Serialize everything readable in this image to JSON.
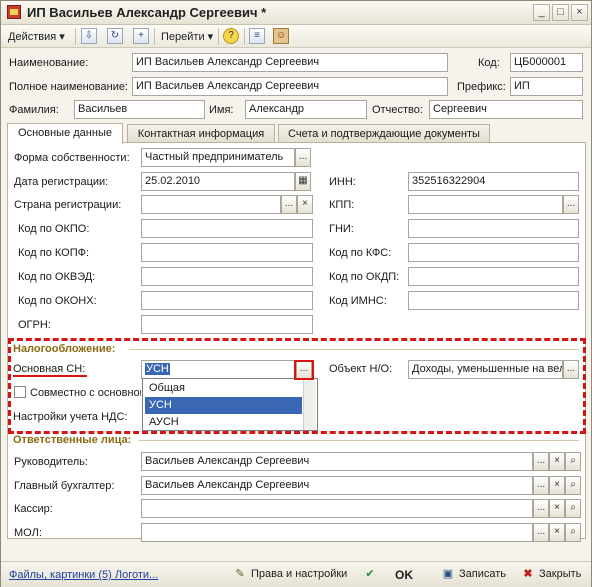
{
  "window": {
    "title": "ИП Васильев Александр Сергеевич *",
    "min_label": "_",
    "max_label": "□",
    "close_label": "×"
  },
  "toolbar": {
    "actions_label": "Действия",
    "goto_label": "Перейти",
    "help_label": "?"
  },
  "header": {
    "name_label": "Наименование:",
    "name_value": "ИП Васильев Александр Сергеевич",
    "code_label": "Код:",
    "code_value": "ЦБ000001",
    "fullname_label": "Полное наименование:",
    "fullname_value": "ИП Васильев Александр Сергеевич",
    "prefix_label": "Префикс:",
    "prefix_value": "ИП",
    "lastname_label": "Фамилия:",
    "lastname_value": "Васильев",
    "firstname_label": "Имя:",
    "firstname_value": "Александр",
    "patronymic_label": "Отчество:",
    "patronymic_value": "Сергеевич"
  },
  "tabs": [
    {
      "label": "Основные данные"
    },
    {
      "label": "Контактная информация"
    },
    {
      "label": "Счета и подтверждающие документы"
    }
  ],
  "main": {
    "ownership_label": "Форма собственности:",
    "ownership_value": "Частный предприниматель",
    "regdate_label": "Дата регистрации:",
    "regdate_value": "25.02.2010",
    "inn_label": "ИНН:",
    "inn_value": "352516322904",
    "country_label": "Страна регистрации:",
    "kpp_label": "КПП:",
    "okpo_label": "Код по ОКПО:",
    "gni_label": "ГНИ:",
    "kopf_label": "Код по КОПФ:",
    "kfs_label": "Код по КФС:",
    "okved_label": "Код по ОКВЭД:",
    "okdp_label": "Код по ОКДП:",
    "okonh_label": "Код по ОКОНХ:",
    "imns_label": "Код ИМНС:",
    "ogrn_label": "ОГРН:"
  },
  "tax": {
    "section_label": "Налогообложение:",
    "system_label": "Основная СН:",
    "system_value": "УСН",
    "object_label": "Объект Н/О:",
    "object_value": "Доходы, уменьшенные на вел",
    "combined_label": "Совместно с основной",
    "vat_label": "Настройки учета НДС:",
    "options": [
      "Общая",
      "УСН",
      "АУСН"
    ],
    "selected_index": 1
  },
  "responsible": {
    "section_label": "Ответственные лица:",
    "director_label": "Руководитель:",
    "director_value": "Васильев Александр Сергеевич",
    "accountant_label": "Главный бухгалтер:",
    "accountant_value": "Васильев Александр Сергеевич",
    "cashier_label": "Кассир:",
    "mol_label": "МОЛ:"
  },
  "footer": {
    "files_link": "Файлы, картинки (5) Логоти...",
    "rights_label": "Права и настройки",
    "ok_label": "OK",
    "save_label": "Записать",
    "close_label": "Закрыть"
  },
  "ui": {
    "ellipsis": "...",
    "dropdown_arrow": "▾",
    "search_symbol": "⌕",
    "calendar_symbol": "▦"
  },
  "colors": {
    "accent_red": "#d61414",
    "section_gold": "#8b6b12",
    "selection_blue": "#3a67b4",
    "link_blue": "#1f3f9e"
  }
}
